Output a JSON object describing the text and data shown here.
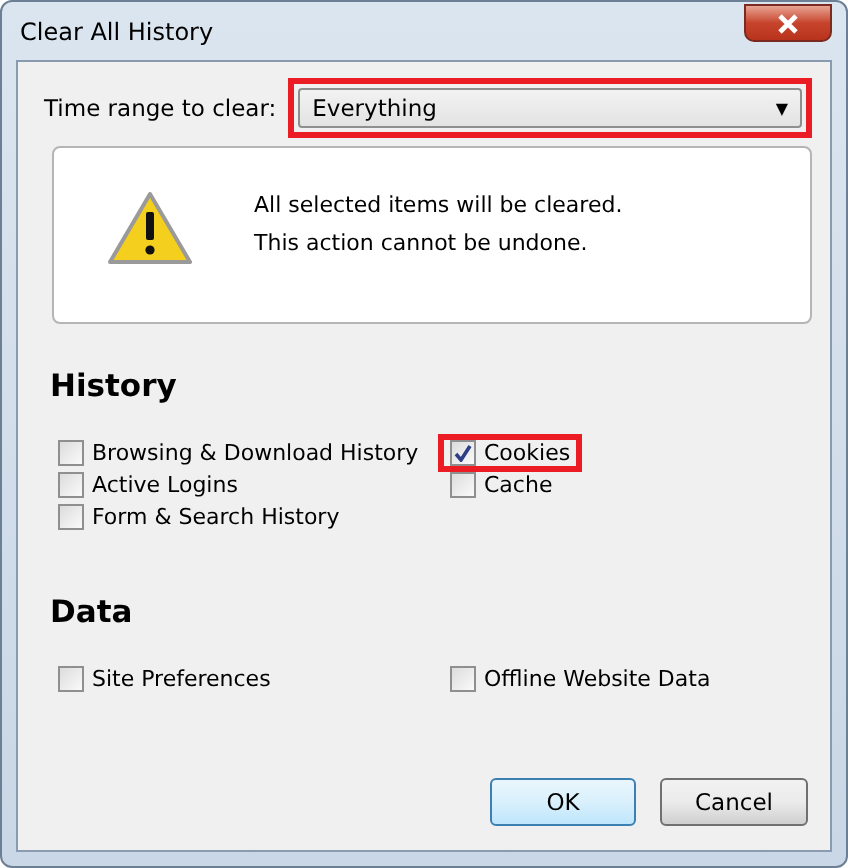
{
  "window": {
    "title": "Clear All History"
  },
  "time_range": {
    "label": "Time range to clear:",
    "value": "Everything",
    "arrow": "▼",
    "highlighted": true
  },
  "warning": {
    "lines": [
      "All selected items will be cleared.",
      "This action cannot be undone."
    ]
  },
  "sections": [
    {
      "heading": "History",
      "columns": [
        [
          {
            "label": "Browsing & Download History",
            "checked": false,
            "highlighted": false
          },
          {
            "label": "Active Logins",
            "checked": false,
            "highlighted": false
          },
          {
            "label": "Form & Search History",
            "checked": false,
            "highlighted": false
          }
        ],
        [
          {
            "label": "Cookies",
            "checked": true,
            "highlighted": true
          },
          {
            "label": "Cache",
            "checked": false,
            "highlighted": false
          }
        ]
      ]
    },
    {
      "heading": "Data",
      "columns": [
        [
          {
            "label": "Site Preferences",
            "checked": false,
            "highlighted": false
          }
        ],
        [
          {
            "label": "Offline Website Data",
            "checked": false,
            "highlighted": false
          }
        ]
      ]
    }
  ],
  "buttons": [
    {
      "label": "OK",
      "default": true
    },
    {
      "label": "Cancel",
      "default": false
    }
  ]
}
